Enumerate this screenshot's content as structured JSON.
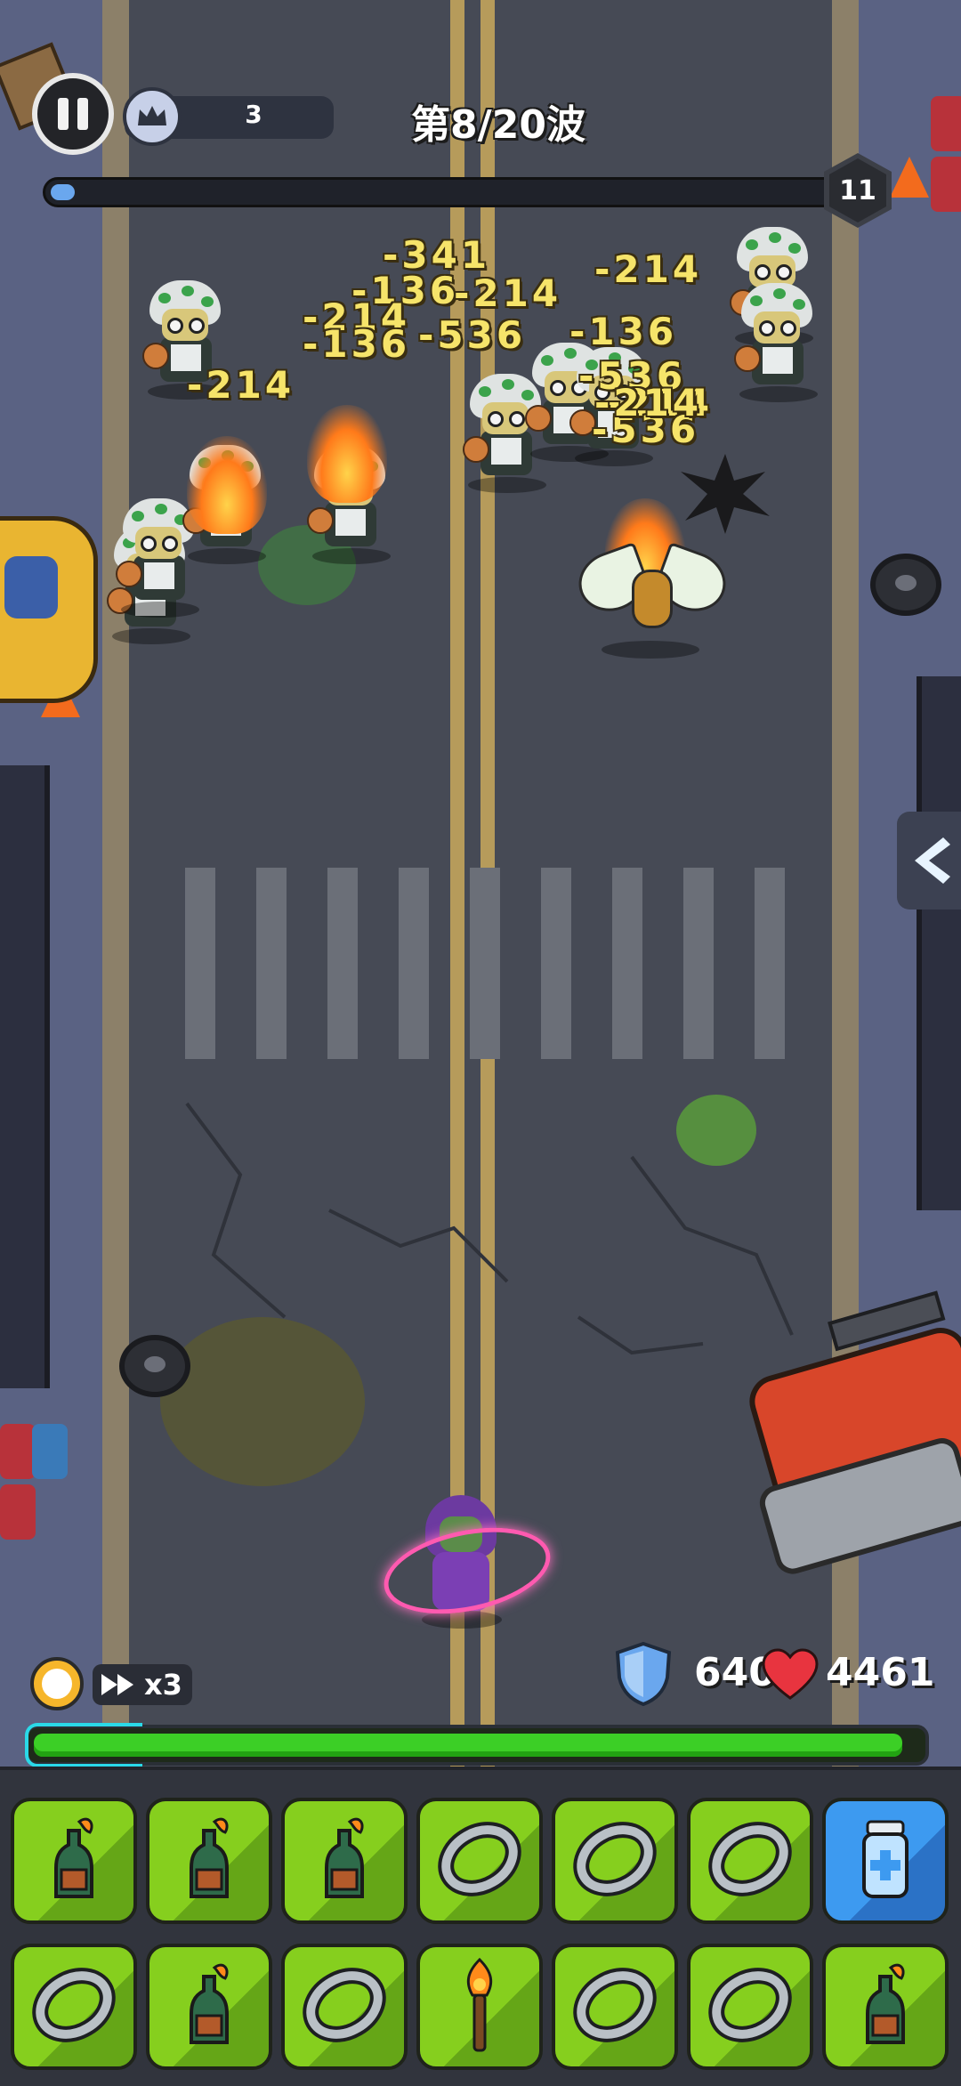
{
  "hud": {
    "crown_count": "3",
    "wave_label": "第8/20波",
    "wave_progress": 0.03,
    "level_badge": "11"
  },
  "combat": {
    "damage_numbers": [
      "-341",
      "-136",
      "-214",
      "-136",
      "-214",
      "-214",
      "-136",
      "-536",
      "-214",
      "-536",
      "-214",
      "-214",
      "-536"
    ]
  },
  "status": {
    "speed_label": "x3",
    "shield_value": "640",
    "hp_value": "4461",
    "hp_fraction": 0.98
  },
  "inventory": {
    "slots": [
      {
        "icon": "molotov-icon",
        "color": "#86cf1e"
      },
      {
        "icon": "molotov-icon",
        "color": "#86cf1e"
      },
      {
        "icon": "molotov-icon",
        "color": "#86cf1e"
      },
      {
        "icon": "ring-icon",
        "color": "#86cf1e"
      },
      {
        "icon": "ring-icon",
        "color": "#86cf1e"
      },
      {
        "icon": "ring-icon",
        "color": "#86cf1e"
      },
      {
        "icon": "medkit-icon",
        "color": "#3d9af0"
      },
      {
        "icon": "ring-icon",
        "color": "#86cf1e"
      },
      {
        "icon": "molotov-icon",
        "color": "#86cf1e"
      },
      {
        "icon": "ring-icon",
        "color": "#86cf1e"
      },
      {
        "icon": "torch-icon",
        "color": "#86cf1e"
      },
      {
        "icon": "ring-icon",
        "color": "#86cf1e"
      },
      {
        "icon": "ring-icon",
        "color": "#86cf1e"
      },
      {
        "icon": "molotov-icon",
        "color": "#86cf1e"
      }
    ]
  }
}
